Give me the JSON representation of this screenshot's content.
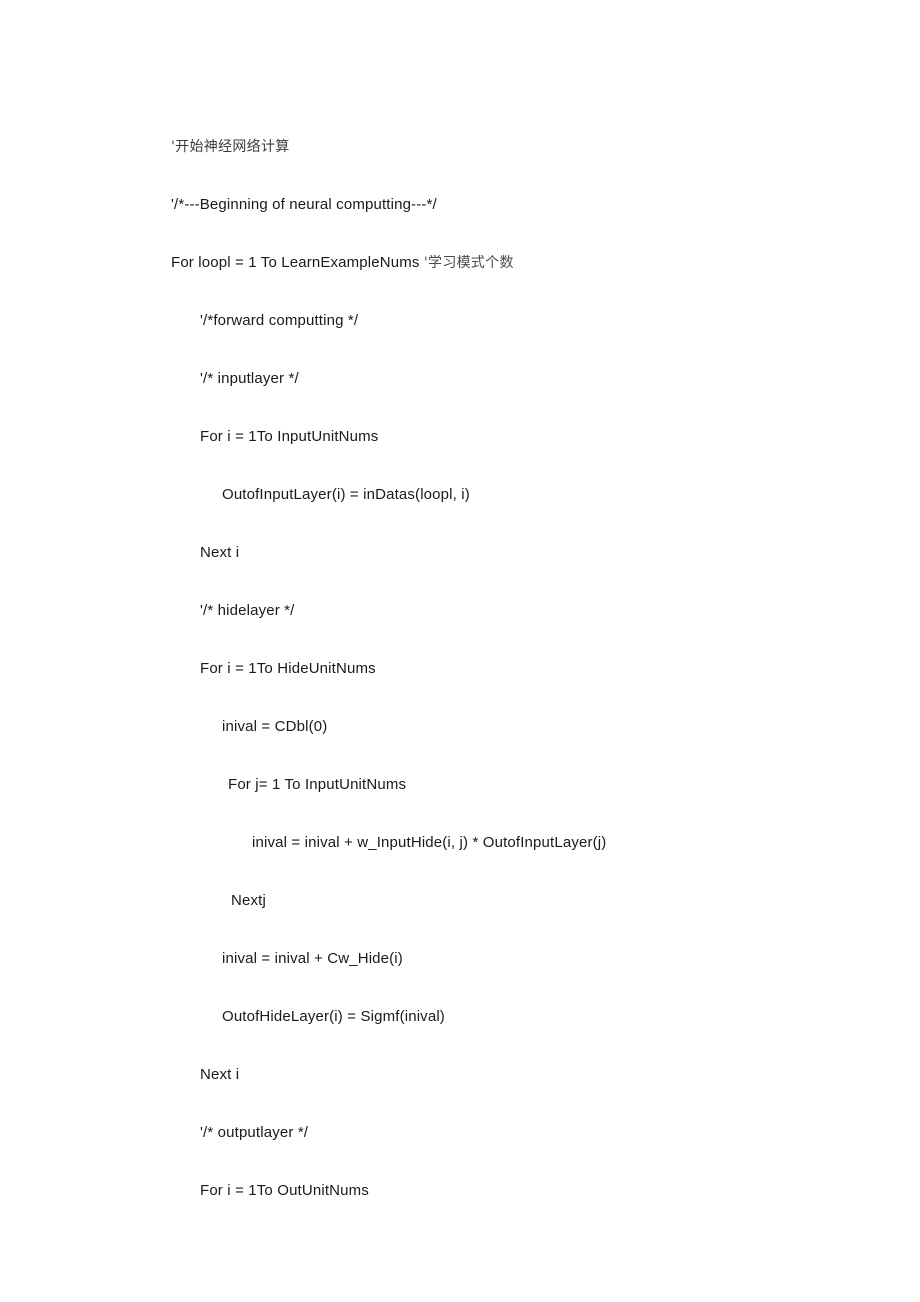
{
  "document": {
    "background_color": "#ffffff",
    "text_color": "#1a1a1a",
    "comment_text_color": "#4a4a4a",
    "language": "VBA / BASIC",
    "lines": [
      {
        "indent": 0,
        "text": "'开始神经网络计算",
        "script": "cjk"
      },
      {
        "indent": 0,
        "text": "'/*---Beginning of neural computting---*/",
        "script": "latin"
      },
      {
        "indent": 0,
        "text": "For loopl = 1 To LearnExampleNums ",
        "script": "latin",
        "comment": "'学习模式个数"
      },
      {
        "indent": 1,
        "text": "'/*forward computting */",
        "script": "latin"
      },
      {
        "indent": 1,
        "text": "'/* inputlayer */",
        "script": "latin"
      },
      {
        "indent": 1,
        "text": "For i = 1To InputUnitNums",
        "script": "latin"
      },
      {
        "indent": 2,
        "text": "OutofInputLayer(i) = inDatas(loopl, i)",
        "script": "latin"
      },
      {
        "indent": 1,
        "text": "Next i",
        "script": "latin"
      },
      {
        "indent": 1,
        "text": "'/* hidelayer */",
        "script": "latin"
      },
      {
        "indent": 1,
        "text": "For i = 1To HideUnitNums",
        "script": "latin"
      },
      {
        "indent": 2,
        "text": "inival = CDbl(0)",
        "script": "latin"
      },
      {
        "indent": 3,
        "text": "For j= 1 To InputUnitNums",
        "script": "latin"
      },
      {
        "indent": 5,
        "text": "inival = inival + w_InputHide(i, j) * OutofInputLayer(j)",
        "script": "latin"
      },
      {
        "indent": 4,
        "text": "Nextj",
        "script": "latin"
      },
      {
        "indent": 2,
        "text": "inival = inival + Cw_Hide(i)",
        "script": "latin"
      },
      {
        "indent": 2,
        "text": "OutofHideLayer(i) = Sigmf(inival)",
        "script": "latin"
      },
      {
        "indent": 1,
        "text": "Next i",
        "script": "latin"
      },
      {
        "indent": 1,
        "text": "'/* outputlayer */",
        "script": "latin"
      },
      {
        "indent": 1,
        "text": "For i = 1To OutUnitNums",
        "script": "latin"
      }
    ]
  }
}
